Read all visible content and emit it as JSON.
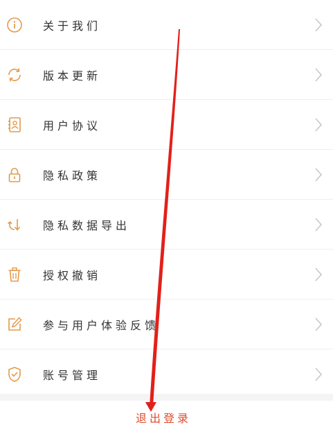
{
  "menu": {
    "items": [
      {
        "label": "关于我们",
        "icon": "info-icon"
      },
      {
        "label": "版本更新",
        "icon": "refresh-icon"
      },
      {
        "label": "用户协议",
        "icon": "contact-card-icon"
      },
      {
        "label": "隐私政策",
        "icon": "lock-icon"
      },
      {
        "label": "隐私数据导出",
        "icon": "export-arrows-icon"
      },
      {
        "label": "授权撤销",
        "icon": "trash-icon"
      },
      {
        "label": "参与用户体验反馈",
        "icon": "edit-icon"
      },
      {
        "label": "账号管理",
        "icon": "shield-check-icon"
      }
    ]
  },
  "logout": {
    "label": "退出登录"
  },
  "colors": {
    "icon": "#e39a4b",
    "text": "#333333",
    "logout": "#e04b2e",
    "annotation": "#e2201a",
    "chevron": "#c8c8c8"
  }
}
